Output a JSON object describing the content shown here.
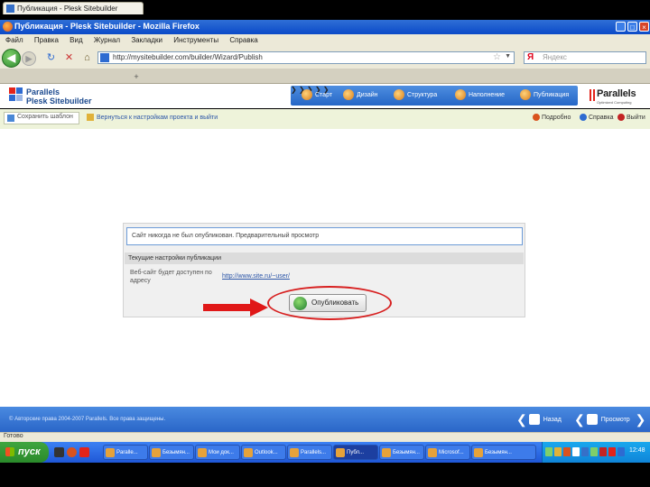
{
  "window": {
    "title": "Публикация - Plesk Sitebuilder - Mozilla Firefox",
    "controls": [
      "_",
      "□",
      "×"
    ]
  },
  "menu": [
    "Файл",
    "Правка",
    "Вид",
    "Журнал",
    "Закладки",
    "Инструменты",
    "Справка"
  ],
  "nav": {
    "url": "http://mysitebuilder.com/builder/Wizard/Publish",
    "search_placeholder": "Яндекс",
    "search_logo": "Я",
    "back_icon": "◀",
    "forward_icon": "▶"
  },
  "tab": {
    "label": "Публикация - Plesk Sitebuilder",
    "close": "×",
    "new": "+"
  },
  "brand": {
    "line1": "Parallels",
    "line2": "Plesk Sitebuilder"
  },
  "steps": [
    "Старт",
    "Дизайн",
    "Структура",
    "Наполнение",
    "Публикация"
  ],
  "parallels_logo": {
    "name": "Parallels",
    "tagline": "Optimized Computing"
  },
  "toolbar": {
    "save_template": "Сохранить шаблон",
    "return_link": "Вернуться к настройкам проекта и выйти",
    "right": [
      "Подробно",
      "Справка",
      "Выйти"
    ]
  },
  "panel": {
    "info": "Сайт никогда не был опубликован. Предварительный просмотр",
    "settings_title": "Текущие настройки публикации",
    "address_label": "Веб-сайт будет доступен по адресу",
    "address_value": "http://www.site.ru/~user/",
    "publish_button": "Опубликовать"
  },
  "footer": {
    "copyright": "© Авторские права 2004-2007 Parallels. Все права защищены.",
    "back": "Назад",
    "preview": "Просмотр"
  },
  "statusbar": "Готово",
  "taskbar": {
    "start": "пуск",
    "tasks": [
      "Paralle...",
      "Безымян...",
      "Мои док...",
      "Outlook...",
      "Parallels...",
      "Публ...",
      "Безымян...",
      "Microsof...",
      "Безымян..."
    ],
    "active_index": 5,
    "clock": "12:48"
  },
  "colors": {
    "accent_blue": "#2566c6",
    "publish_green": "#1e7a2f",
    "annotation_red": "#d72020"
  }
}
